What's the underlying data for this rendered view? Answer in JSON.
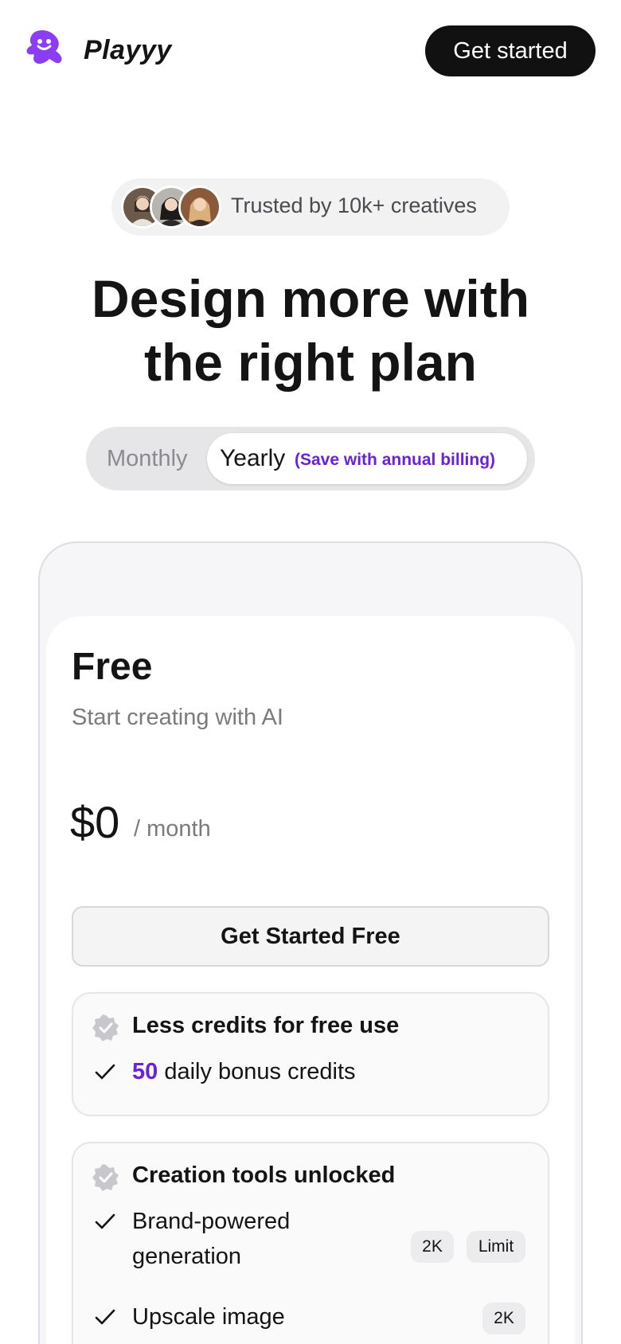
{
  "header": {
    "brand": "Playyy",
    "cta_label": "Get started"
  },
  "hero": {
    "trust_text": "Trusted by 10k+ creatives",
    "headline_line1": "Design more with",
    "headline_line2": "the right plan"
  },
  "billing_toggle": {
    "monthly_label": "Monthly",
    "yearly_label": "Yearly",
    "save_note": "(Save with annual billing)",
    "selected": "Yearly"
  },
  "plan": {
    "name": "Free",
    "description": "Start creating with AI",
    "price": "$0",
    "period": "/ month",
    "cta_label": "Get Started Free",
    "groups": [
      {
        "title": "Less credits for free use",
        "features": [
          {
            "accent": "50",
            "text": " daily bonus credits"
          }
        ]
      },
      {
        "title": "Creation tools unlocked",
        "features": [
          {
            "text_line1": "Brand-powered",
            "text_line2": "generation",
            "tags": [
              "2K",
              "Limit"
            ]
          },
          {
            "text": "Upscale image",
            "tags": [
              "2K"
            ]
          }
        ]
      }
    ]
  },
  "colors": {
    "accent": "#6a22d8",
    "logo": "#8b3df2",
    "button_dark": "#111111"
  },
  "icons": {
    "logo": "playyy-logo-icon",
    "group_badge": "verified-badge-icon",
    "feature": "check-icon"
  }
}
